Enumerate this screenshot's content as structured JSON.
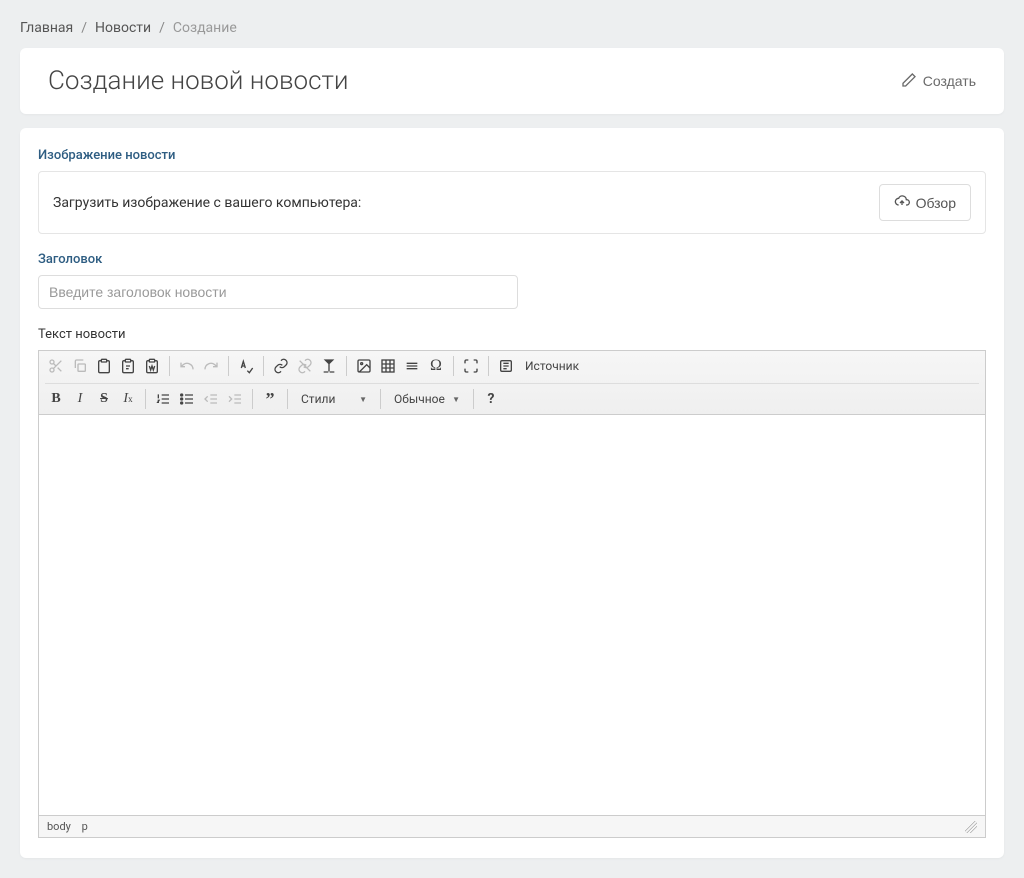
{
  "breadcrumb": {
    "home": "Главная",
    "news": "Новости",
    "current": "Создание"
  },
  "header": {
    "title": "Создание новой новости",
    "create_btn": "Создать"
  },
  "image_section": {
    "label": "Изображение новости",
    "upload_text": "Загрузить изображение с вашего компьютера:",
    "browse_btn": "Обзор"
  },
  "title_section": {
    "label": "Заголовок",
    "placeholder": "Введите заголовок новости"
  },
  "text_section": {
    "label": "Текст новости"
  },
  "editor": {
    "source_btn": "Источник",
    "styles_dropdown": "Стили",
    "format_dropdown": "Обычное",
    "footer_path": {
      "body": "body",
      "p": "p"
    }
  }
}
